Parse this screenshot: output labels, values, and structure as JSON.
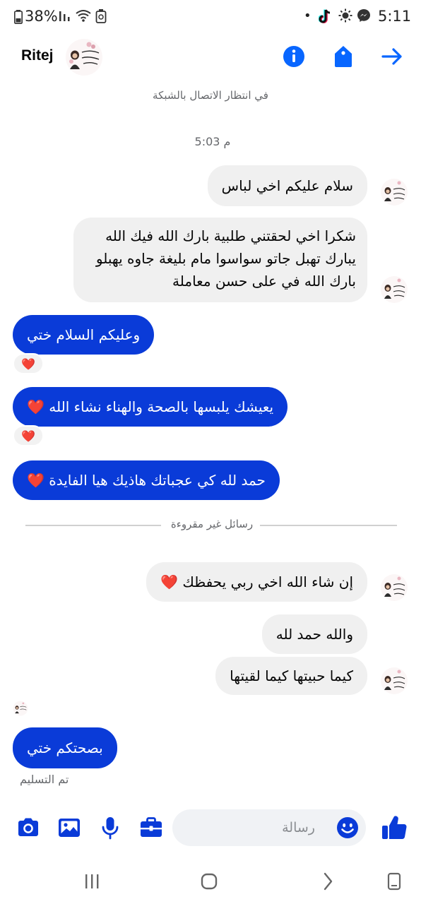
{
  "status_bar": {
    "battery": "38%",
    "time": "5:11",
    "dot": "•"
  },
  "header": {
    "title": "Ritej"
  },
  "connecting_text": "في انتظار الاتصال بالشبكة",
  "timestamp": "5:03 م",
  "messages": [
    {
      "text": "سلام عليكم اخي لباس"
    },
    {
      "text": "شكرا اخي  لحقتني طلبية بارك الله فيك الله يبارك تهبل جاتو سواسوا مام بليغة جاوه يهبلو بارك الله في على حسن معاملة"
    },
    {
      "text": "وعليكم السلام ختي"
    },
    {
      "text": "يعيشك يلبسها بالصحة والهناء نشاء الله",
      "emoji": "❤️"
    },
    {
      "text": "حمد لله كي عجباتك هاذيك هيا الفايدة",
      "emoji": "❤️"
    },
    {
      "text": "إن شاء الله اخي ربي يحفظك",
      "emoji": "❤️"
    },
    {
      "text": "والله حمد لله"
    },
    {
      "text": "كيما حبيتها كيما لقيتها"
    },
    {
      "text": "بصحتكم ختي"
    }
  ],
  "reactions": [
    "❤️",
    "❤️"
  ],
  "unread_divider": "رسائل غير مقروءة",
  "delivered_status": "تم التسليم",
  "composer": {
    "placeholder": "رسالة"
  },
  "colors": {
    "accent": "#0a3bd8",
    "icon_blue": "#0866ff",
    "incoming_bubble": "#f0f0f0",
    "heart": "#e0262e"
  },
  "icons": {
    "header": [
      "info-icon",
      "tag-icon",
      "forward-arrow-icon"
    ],
    "toolbar": [
      "camera-icon",
      "gallery-icon",
      "microphone-icon",
      "briefcase-icon",
      "emoji-icon",
      "thumbs-up-icon"
    ],
    "nav": [
      "recent-apps-icon",
      "home-icon",
      "back-icon",
      "screenshot-icon"
    ]
  }
}
